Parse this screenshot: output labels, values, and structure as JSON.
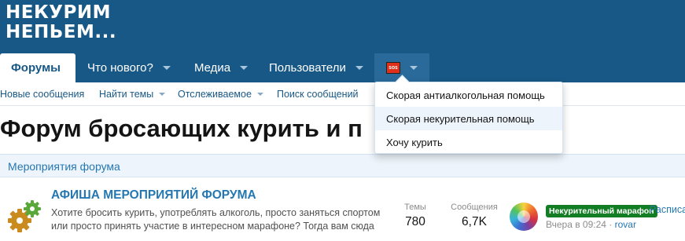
{
  "logo": {
    "line1": "НЕКУРИМ",
    "line2": "НЕПЬЕМ..."
  },
  "nav": {
    "tabs": [
      {
        "label": "Форумы"
      },
      {
        "label": "Что нового?"
      },
      {
        "label": "Медиа"
      },
      {
        "label": "Пользователи"
      }
    ],
    "sos_icon_label": "SOS"
  },
  "subnav": {
    "items": [
      {
        "label": "Новые сообщения"
      },
      {
        "label": "Найти темы"
      },
      {
        "label": "Отслеживаемое"
      },
      {
        "label": "Поиск сообщений"
      }
    ]
  },
  "dropdown": {
    "items": [
      {
        "label": "Скорая антиалкогольная помощь"
      },
      {
        "label": "Скорая некурительная помощь"
      },
      {
        "label": "Хочу курить"
      }
    ]
  },
  "page": {
    "title": "Форум бросающих курить и п"
  },
  "node_section": {
    "title": "Мероприятия форума"
  },
  "forum": {
    "title": "АФИША МЕРОПРИЯТИЙ ФОРУМА",
    "description": "Хотите бросить курить, употреблять алкоголь, просто заняться спортом или просто принять участие в интересном марафоне? Тогда вам сюда",
    "threads_label": "Темы",
    "threads_value": "780",
    "messages_label": "Сообщения",
    "messages_value": "6,7K",
    "latest": {
      "prefix": "Некурительный марафон",
      "title": "Расписа",
      "time": "Вчера в 09:24",
      "separator": "·",
      "user": "rovar"
    }
  },
  "colors": {
    "header": "#185886",
    "link": "#2577b1",
    "prefix": "#127d23"
  }
}
